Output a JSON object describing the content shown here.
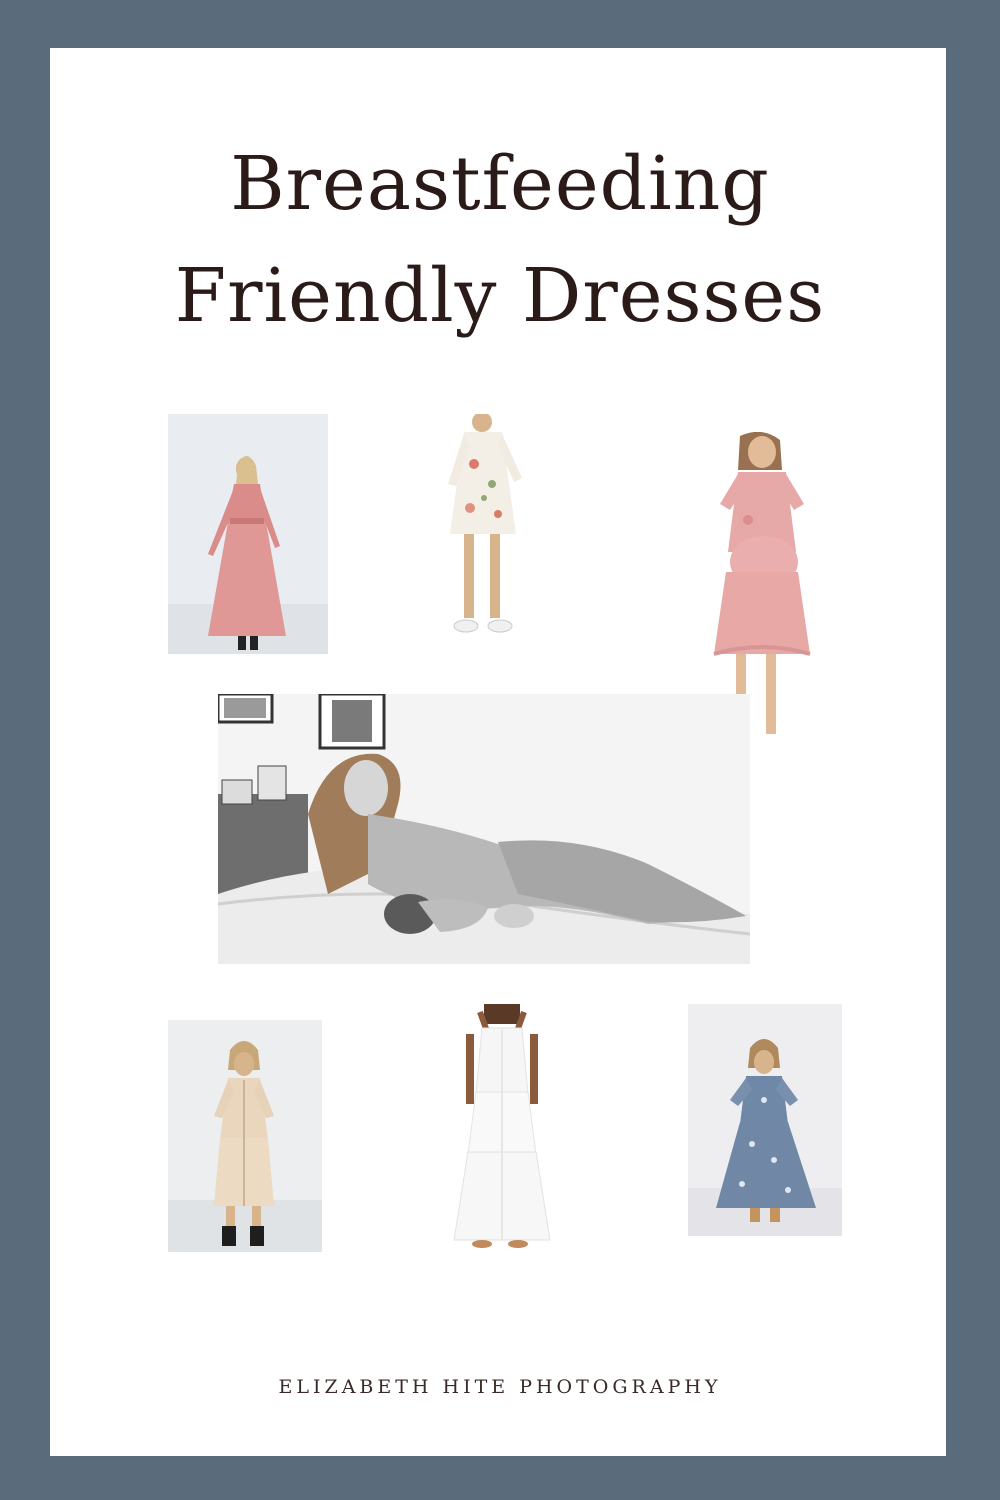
{
  "title": {
    "line1": "Breastfeeding",
    "line2": "Friendly Dresses"
  },
  "footer": {
    "credit": "ELIZABETH HITE PHOTOGRAPHY"
  },
  "colors": {
    "border": "#5a6b7c",
    "background": "#ffffff",
    "text": "#2a1a18"
  }
}
